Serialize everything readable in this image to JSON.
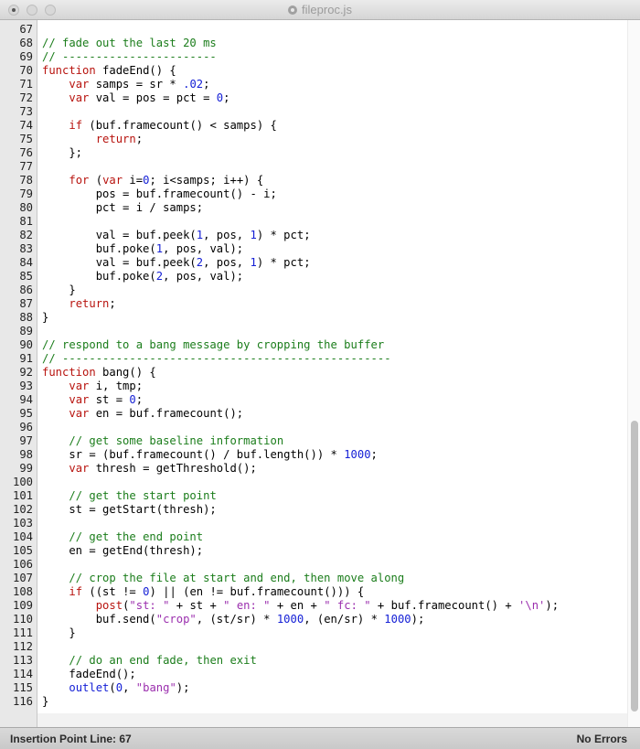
{
  "window": {
    "title": "fileproc.js"
  },
  "status": {
    "insertion_point": "Insertion Point Line: 67",
    "errors": "No Errors"
  },
  "colors": {
    "keyword": "#b8140f",
    "comment": "#1b7d1b",
    "number": "#1520d6",
    "string": "#9b2fae"
  },
  "lines": [
    {
      "n": "67",
      "t": []
    },
    {
      "n": "68",
      "t": [
        [
          "cm",
          "// fade out the last 20 ms"
        ]
      ]
    },
    {
      "n": "69",
      "t": [
        [
          "cm",
          "// -----------------------"
        ]
      ]
    },
    {
      "n": "70",
      "t": [
        [
          "kw",
          "function"
        ],
        [
          "tx",
          " fadeEnd() {"
        ]
      ]
    },
    {
      "n": "71",
      "t": [
        [
          "tx",
          "    "
        ],
        [
          "kw",
          "var"
        ],
        [
          "tx",
          " samps = sr * "
        ],
        [
          "nm",
          ".02"
        ],
        [
          "tx",
          ";"
        ]
      ]
    },
    {
      "n": "72",
      "t": [
        [
          "tx",
          "    "
        ],
        [
          "kw",
          "var"
        ],
        [
          "tx",
          " val = pos = pct = "
        ],
        [
          "nm",
          "0"
        ],
        [
          "tx",
          ";"
        ]
      ]
    },
    {
      "n": "73",
      "t": []
    },
    {
      "n": "74",
      "t": [
        [
          "tx",
          "    "
        ],
        [
          "kw",
          "if"
        ],
        [
          "tx",
          " (buf.framecount() < samps) {"
        ]
      ]
    },
    {
      "n": "75",
      "t": [
        [
          "tx",
          "        "
        ],
        [
          "kw",
          "return"
        ],
        [
          "tx",
          ";"
        ]
      ]
    },
    {
      "n": "76",
      "t": [
        [
          "tx",
          "    };"
        ]
      ]
    },
    {
      "n": "77",
      "t": []
    },
    {
      "n": "78",
      "t": [
        [
          "tx",
          "    "
        ],
        [
          "kw",
          "for"
        ],
        [
          "tx",
          " ("
        ],
        [
          "kw",
          "var"
        ],
        [
          "tx",
          " i="
        ],
        [
          "nm",
          "0"
        ],
        [
          "tx",
          "; i<samps; i++) {"
        ]
      ]
    },
    {
      "n": "79",
      "t": [
        [
          "tx",
          "        pos = buf.framecount() - i;"
        ]
      ]
    },
    {
      "n": "80",
      "t": [
        [
          "tx",
          "        pct = i / samps;"
        ]
      ]
    },
    {
      "n": "81",
      "t": []
    },
    {
      "n": "82",
      "t": [
        [
          "tx",
          "        val = buf.peek("
        ],
        [
          "nm",
          "1"
        ],
        [
          "tx",
          ", pos, "
        ],
        [
          "nm",
          "1"
        ],
        [
          "tx",
          ") * pct;"
        ]
      ]
    },
    {
      "n": "83",
      "t": [
        [
          "tx",
          "        buf.poke("
        ],
        [
          "nm",
          "1"
        ],
        [
          "tx",
          ", pos, val);"
        ]
      ]
    },
    {
      "n": "84",
      "t": [
        [
          "tx",
          "        val = buf.peek("
        ],
        [
          "nm",
          "2"
        ],
        [
          "tx",
          ", pos, "
        ],
        [
          "nm",
          "1"
        ],
        [
          "tx",
          ") * pct;"
        ]
      ]
    },
    {
      "n": "85",
      "t": [
        [
          "tx",
          "        buf.poke("
        ],
        [
          "nm",
          "2"
        ],
        [
          "tx",
          ", pos, val);"
        ]
      ]
    },
    {
      "n": "86",
      "t": [
        [
          "tx",
          "    }"
        ]
      ]
    },
    {
      "n": "87",
      "t": [
        [
          "tx",
          "    "
        ],
        [
          "kw",
          "return"
        ],
        [
          "tx",
          ";"
        ]
      ]
    },
    {
      "n": "88",
      "t": [
        [
          "tx",
          "}"
        ]
      ]
    },
    {
      "n": "89",
      "t": []
    },
    {
      "n": "90",
      "t": [
        [
          "cm",
          "// respond to a bang message by cropping the buffer"
        ]
      ]
    },
    {
      "n": "91",
      "t": [
        [
          "cm",
          "// -------------------------------------------------"
        ]
      ]
    },
    {
      "n": "92",
      "t": [
        [
          "kw",
          "function"
        ],
        [
          "tx",
          " bang() {"
        ]
      ]
    },
    {
      "n": "93",
      "t": [
        [
          "tx",
          "    "
        ],
        [
          "kw",
          "var"
        ],
        [
          "tx",
          " i, tmp;"
        ]
      ]
    },
    {
      "n": "94",
      "t": [
        [
          "tx",
          "    "
        ],
        [
          "kw",
          "var"
        ],
        [
          "tx",
          " st = "
        ],
        [
          "nm",
          "0"
        ],
        [
          "tx",
          ";"
        ]
      ]
    },
    {
      "n": "95",
      "t": [
        [
          "tx",
          "    "
        ],
        [
          "kw",
          "var"
        ],
        [
          "tx",
          " en = buf.framecount();"
        ]
      ]
    },
    {
      "n": "96",
      "t": []
    },
    {
      "n": "97",
      "t": [
        [
          "tx",
          "    "
        ],
        [
          "cm",
          "// get some baseline information"
        ]
      ]
    },
    {
      "n": "98",
      "t": [
        [
          "tx",
          "    sr = (buf.framecount() / buf.length()) * "
        ],
        [
          "nm",
          "1000"
        ],
        [
          "tx",
          ";"
        ]
      ]
    },
    {
      "n": "99",
      "t": [
        [
          "tx",
          "    "
        ],
        [
          "kw",
          "var"
        ],
        [
          "tx",
          " thresh = getThreshold();"
        ]
      ]
    },
    {
      "n": "100",
      "t": []
    },
    {
      "n": "101",
      "t": [
        [
          "tx",
          "    "
        ],
        [
          "cm",
          "// get the start point"
        ]
      ]
    },
    {
      "n": "102",
      "t": [
        [
          "tx",
          "    st = getStart(thresh);"
        ]
      ]
    },
    {
      "n": "103",
      "t": []
    },
    {
      "n": "104",
      "t": [
        [
          "tx",
          "    "
        ],
        [
          "cm",
          "// get the end point"
        ]
      ]
    },
    {
      "n": "105",
      "t": [
        [
          "tx",
          "    en = getEnd(thresh);"
        ]
      ]
    },
    {
      "n": "106",
      "t": []
    },
    {
      "n": "107",
      "t": [
        [
          "tx",
          "    "
        ],
        [
          "cm",
          "// crop the file at start and end, then move along"
        ]
      ]
    },
    {
      "n": "108",
      "t": [
        [
          "tx",
          "    "
        ],
        [
          "kw",
          "if"
        ],
        [
          "tx",
          " ((st != "
        ],
        [
          "nm",
          "0"
        ],
        [
          "tx",
          ") || (en != buf.framecount())) {"
        ]
      ]
    },
    {
      "n": "109",
      "t": [
        [
          "tx",
          "        "
        ],
        [
          "kw",
          "post"
        ],
        [
          "tx",
          "("
        ],
        [
          "st",
          "\"st: \""
        ],
        [
          "tx",
          " + st + "
        ],
        [
          "st",
          "\" en: \""
        ],
        [
          "tx",
          " + en + "
        ],
        [
          "st",
          "\" fc: \""
        ],
        [
          "tx",
          " + buf.framecount() + "
        ],
        [
          "st",
          "'\\n'"
        ],
        [
          "tx",
          ");"
        ]
      ]
    },
    {
      "n": "110",
      "t": [
        [
          "tx",
          "        buf.send("
        ],
        [
          "st",
          "\"crop\""
        ],
        [
          "tx",
          ", (st/sr) * "
        ],
        [
          "nm",
          "1000"
        ],
        [
          "tx",
          ", (en/sr) * "
        ],
        [
          "nm",
          "1000"
        ],
        [
          "tx",
          ");"
        ]
      ]
    },
    {
      "n": "111",
      "t": [
        [
          "tx",
          "    }"
        ]
      ]
    },
    {
      "n": "112",
      "t": []
    },
    {
      "n": "113",
      "t": [
        [
          "tx",
          "    "
        ],
        [
          "cm",
          "// do an end fade, then exit"
        ]
      ]
    },
    {
      "n": "114",
      "t": [
        [
          "tx",
          "    fadeEnd();"
        ]
      ]
    },
    {
      "n": "115",
      "t": [
        [
          "tx",
          "    "
        ],
        [
          "nm",
          "outlet"
        ],
        [
          "tx",
          "("
        ],
        [
          "nm",
          "0"
        ],
        [
          "tx",
          ", "
        ],
        [
          "st",
          "\"bang\""
        ],
        [
          "tx",
          ");"
        ]
      ]
    },
    {
      "n": "116",
      "t": [
        [
          "tx",
          "}"
        ]
      ]
    }
  ]
}
